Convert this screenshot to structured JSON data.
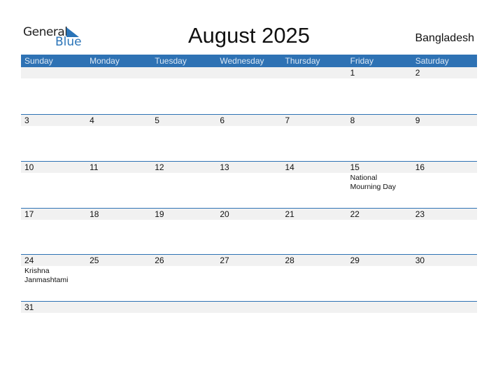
{
  "logo": {
    "line1": "General",
    "line2": "Blue"
  },
  "title": "August 2025",
  "country": "Bangladesh",
  "weekdays": [
    "Sunday",
    "Monday",
    "Tuesday",
    "Wednesday",
    "Thursday",
    "Friday",
    "Saturday"
  ],
  "weeks": [
    [
      {
        "d": ""
      },
      {
        "d": ""
      },
      {
        "d": ""
      },
      {
        "d": ""
      },
      {
        "d": ""
      },
      {
        "d": "1"
      },
      {
        "d": "2"
      }
    ],
    [
      {
        "d": "3"
      },
      {
        "d": "4"
      },
      {
        "d": "5"
      },
      {
        "d": "6"
      },
      {
        "d": "7"
      },
      {
        "d": "8"
      },
      {
        "d": "9"
      }
    ],
    [
      {
        "d": "10"
      },
      {
        "d": "11"
      },
      {
        "d": "12"
      },
      {
        "d": "13"
      },
      {
        "d": "14"
      },
      {
        "d": "15",
        "e": "National Mourning Day"
      },
      {
        "d": "16"
      }
    ],
    [
      {
        "d": "17"
      },
      {
        "d": "18"
      },
      {
        "d": "19"
      },
      {
        "d": "20"
      },
      {
        "d": "21"
      },
      {
        "d": "22"
      },
      {
        "d": "23"
      }
    ],
    [
      {
        "d": "24",
        "e": "Krishna Janmashtami"
      },
      {
        "d": "25"
      },
      {
        "d": "26"
      },
      {
        "d": "27"
      },
      {
        "d": "28"
      },
      {
        "d": "29"
      },
      {
        "d": "30"
      }
    ],
    [
      {
        "d": "31"
      },
      {
        "d": ""
      },
      {
        "d": ""
      },
      {
        "d": ""
      },
      {
        "d": ""
      },
      {
        "d": ""
      },
      {
        "d": ""
      }
    ]
  ],
  "colors": {
    "accent": "#2e72b4",
    "strip": "#f1f1f1"
  }
}
